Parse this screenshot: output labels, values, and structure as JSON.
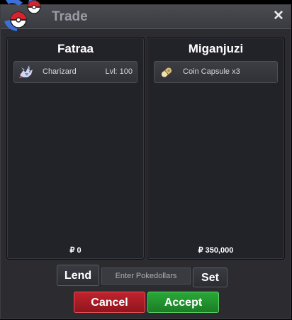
{
  "window": {
    "title": "Trade",
    "close_label": "✕"
  },
  "left_panel": {
    "player_name": "Fatraa",
    "items": [
      {
        "icon": "charizard-sprite-icon",
        "name": "Charizard",
        "level": "Lvl: 100"
      }
    ],
    "money": "₽ 0"
  },
  "right_panel": {
    "player_name": "Miganjuzi",
    "items": [
      {
        "icon": "coin-capsule-icon",
        "name": "Coin Capsule  x3"
      }
    ],
    "money": "₽ 350,000"
  },
  "controls": {
    "lend_label": "Lend",
    "pokedollars_placeholder": "Enter Pokedollars",
    "set_label": "Set",
    "cancel_label": "Cancel",
    "accept_label": "Accept"
  },
  "colors": {
    "accept": "#2aa838",
    "cancel": "#c0232d",
    "window_bg": "#2b2b30",
    "panel_bg": "#222229"
  }
}
